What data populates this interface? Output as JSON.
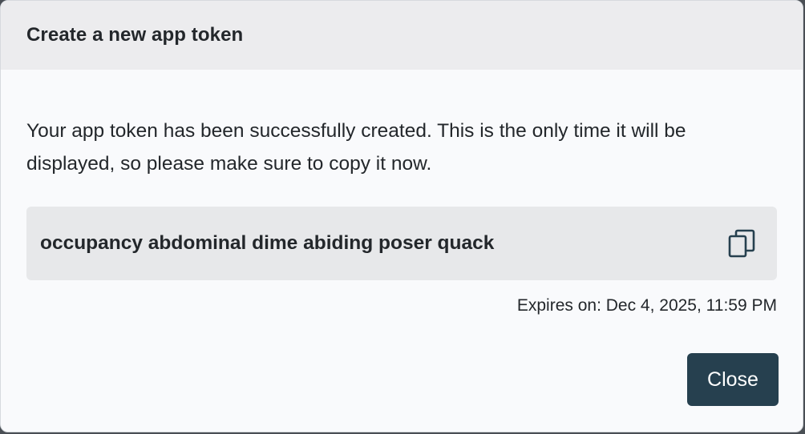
{
  "dialog": {
    "title": "Create a new app token",
    "message": "Your app token has been successfully created. This is the only time it will be displayed, so please make sure to copy it now.",
    "token": "occupancy abdominal dime abiding poser quack",
    "copy_icon": "copy-icon",
    "expires": "Expires on: Dec 4, 2025, 11:59 PM",
    "close_label": "Close"
  },
  "colors": {
    "header_bg": "#ececee",
    "body_bg": "#f9fafc",
    "token_bg": "#e7e8ea",
    "button_bg": "#26404f",
    "text": "#23272b"
  }
}
